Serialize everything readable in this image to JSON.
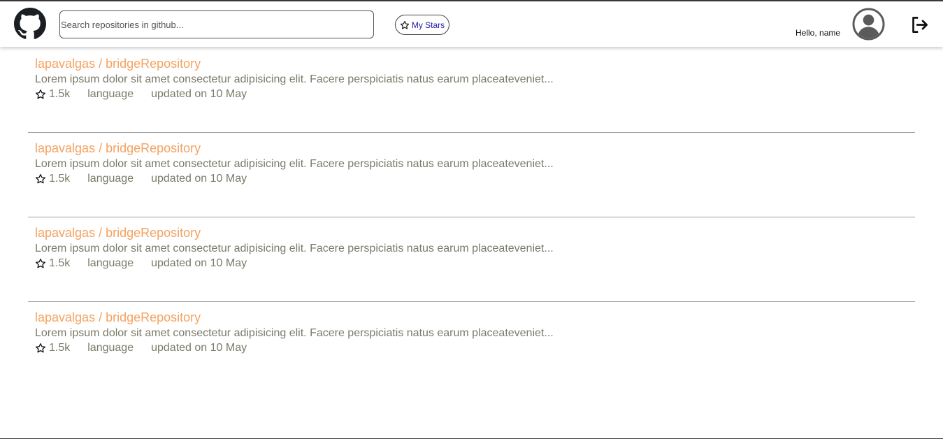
{
  "header": {
    "logo_icon": "github-icon",
    "search": {
      "placeholder": "Search repositories in github...",
      "value": ""
    },
    "stars_button": {
      "icon": "star-outline-icon",
      "label": "My Stars"
    },
    "greeting": "Hello, name",
    "avatar_icon": "user-avatar-icon",
    "logout_icon": "logout-icon"
  },
  "colors": {
    "repo_title": "#f4a261",
    "repo_text": "#7a7a6a",
    "stars_label": "#1a1aa6"
  },
  "repositories": [
    {
      "title": "lapavalgas / bridgeRepository",
      "description": "Lorem ipsum dolor sit amet consectetur adipisicing elit. Facere perspiciatis natus earum placeateveniet...",
      "stars": "1.5k",
      "language": "language",
      "updated": "updated on 10 May"
    },
    {
      "title": "lapavalgas / bridgeRepository",
      "description": "Lorem ipsum dolor sit amet consectetur adipisicing elit. Facere perspiciatis natus earum placeateveniet...",
      "stars": "1.5k",
      "language": "language",
      "updated": "updated on 10 May"
    },
    {
      "title": "lapavalgas / bridgeRepository",
      "description": "Lorem ipsum dolor sit amet consectetur adipisicing elit. Facere perspiciatis natus earum placeateveniet...",
      "stars": "1.5k",
      "language": "language",
      "updated": "updated on 10 May"
    },
    {
      "title": "lapavalgas / bridgeRepository",
      "description": "Lorem ipsum dolor sit amet consectetur adipisicing elit. Facere perspiciatis natus earum placeateveniet...",
      "stars": "1.5k",
      "language": "language",
      "updated": "updated on 10 May"
    }
  ]
}
